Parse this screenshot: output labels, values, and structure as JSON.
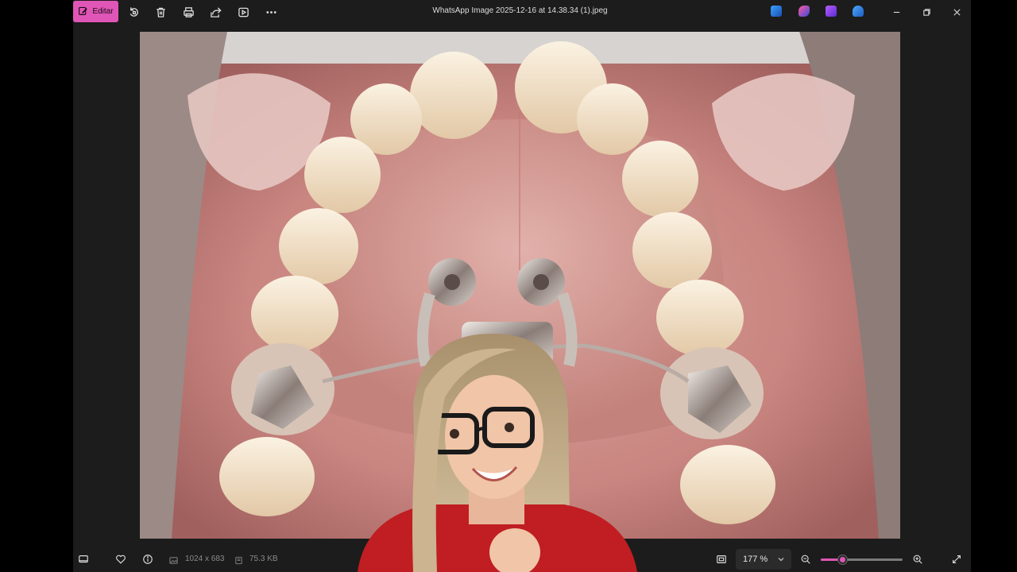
{
  "window": {
    "title": "WhatsApp Image 2025-12-16 at 14.38.34 (1).jpeg"
  },
  "toolbar": {
    "edit_label": "Editar",
    "icons": [
      "edit-icon",
      "rotate-icon",
      "delete-icon",
      "print-icon",
      "share-icon",
      "slideshow-icon",
      "more-icon"
    ]
  },
  "taskbar_apps": [
    {
      "name": "app-icon-1",
      "color": "#2d7fd6"
    },
    {
      "name": "app-icon-2",
      "color": "#c7429a"
    },
    {
      "name": "app-icon-3",
      "color": "#7b3fd1"
    },
    {
      "name": "app-icon-4",
      "color": "#2b6cc4"
    }
  ],
  "image_info": {
    "dimensions": "1024 x 683",
    "file_size": "75.3 KB"
  },
  "zoom": {
    "value_label": "177 %",
    "slider_fraction": 0.26
  },
  "colors": {
    "accent": "#e056b6",
    "background": "#1c1c1c"
  }
}
